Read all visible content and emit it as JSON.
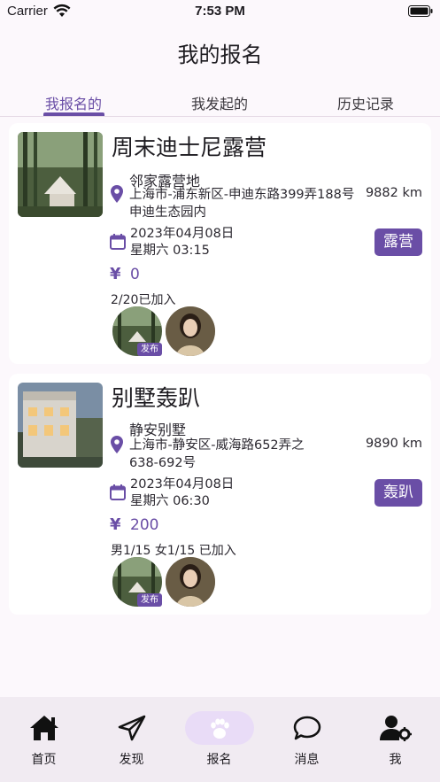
{
  "status_bar": {
    "carrier": "Carrier",
    "time": "7:53 PM"
  },
  "page_title": "我的报名",
  "tabs": [
    {
      "label": "我报名的",
      "active": true
    },
    {
      "label": "我发起的",
      "active": false
    },
    {
      "label": "历史记录",
      "active": false
    }
  ],
  "cards": [
    {
      "title": "周末迪士尼露营",
      "venue": "邻家露营地",
      "address": "上海市-浦东新区-申迪东路399弄188号申迪生态园内",
      "distance": "9882 km",
      "date": "2023年04月08日",
      "weekday_time": "星期六 03:15",
      "tag": "露营",
      "currency": "¥",
      "price": "0",
      "joined": "2/20已加入",
      "avatar_badge": "发布"
    },
    {
      "title": "别墅轰趴",
      "venue": "静安别墅",
      "address": "上海市-静安区-威海路652弄之638-692号",
      "distance": "9890 km",
      "date": "2023年04月08日",
      "weekday_time": "星期六 06:30",
      "tag": "轰趴",
      "currency": "¥",
      "price": "200",
      "joined": "男1/15 女1/15 已加入",
      "avatar_badge": "发布"
    }
  ],
  "bottom_nav": [
    {
      "label": "首页",
      "icon": "home-icon",
      "active": false
    },
    {
      "label": "发现",
      "icon": "send-icon",
      "active": false
    },
    {
      "label": "报名",
      "icon": "paw-icon",
      "active": true
    },
    {
      "label": "消息",
      "icon": "chat-bubble-icon",
      "active": false
    },
    {
      "label": "我",
      "icon": "user-settings-icon",
      "active": false
    }
  ],
  "colors": {
    "accent": "#6a4ea6",
    "background": "#fcf8fc",
    "nav_background": "#f1ebf2",
    "active_pill": "#e9dcf7"
  }
}
